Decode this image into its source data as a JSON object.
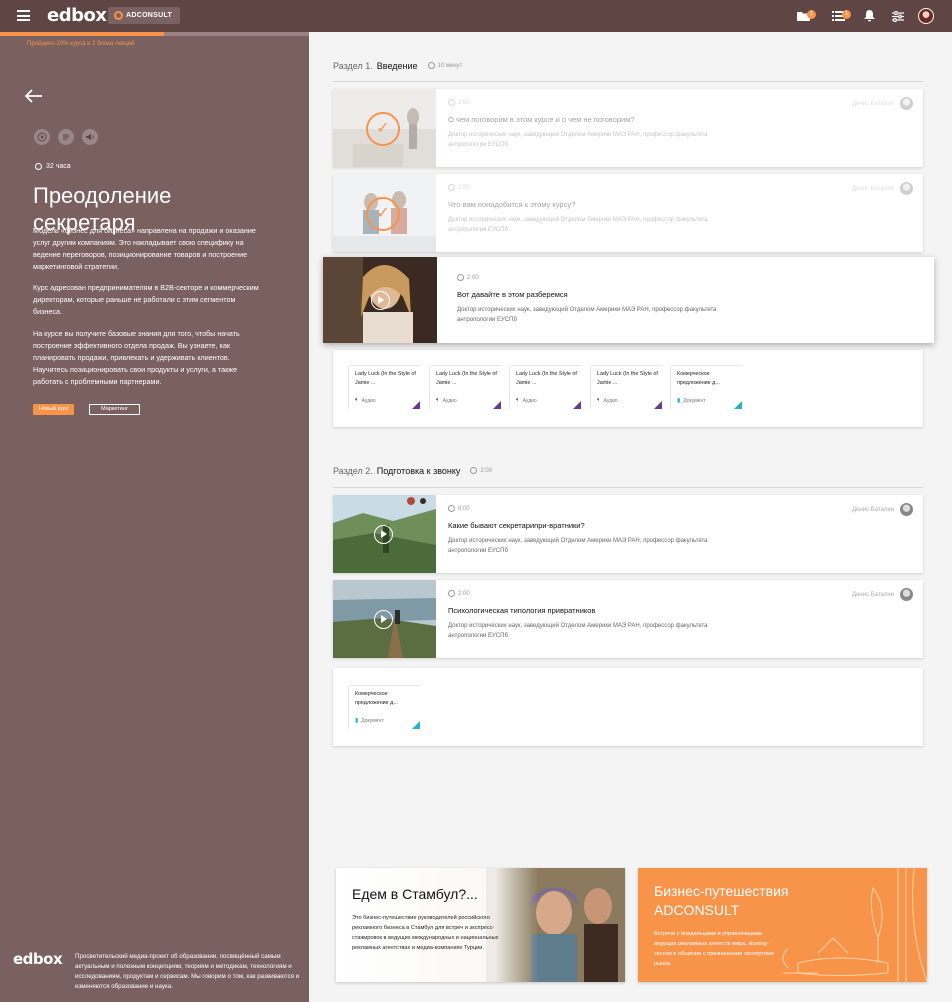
{
  "topbar": {
    "logo": "edbox",
    "partner_badge": "ADCONSULT",
    "folder_count": "1",
    "list_count": "1"
  },
  "course": {
    "progress_text": "Пройдено 20% курса и 2 блока лекций",
    "progress_percent": 53,
    "duration": "32 часа",
    "title": "Преодоление секретаря",
    "paragraphs": [
      "Модель «бизнес для бизнеса» направлена на продажи и оказание услуг другим компаниям. Это накладывает свою специфику на ведение переговоров, позиционирование товаров и построение маркетинговой стратегии.",
      "Курс адресован предпринимателям в B2B-секторе и коммерческим директорам, которые раньше не работали с этим сегментом бизнеса.",
      "На курсе вы получите базовые знания для того, чтобы начать построение эффективного отдела продаж. Вы узнаете, как планировать продажи, привлекать и удерживать клиентов. Научитесь позиционировать свои продукты и услуги, а также работать с проблемными партнерами."
    ],
    "tags": [
      "Новый курс",
      "Маркетинг"
    ]
  },
  "footer": {
    "logo": "edbox",
    "text": "Просветительский медиа-проект об образовании, посвящённый самым актуальным и полезным концепциям, теориям и методикам, технологиям и исследованиям, продуктам и сервисам. Мы говорим о том, как развиваются и изменяются образование и наука."
  },
  "sections": [
    {
      "prefix": "Раздел 1.",
      "name": "Введение",
      "duration": "10 минут",
      "lessons": [
        {
          "duration": "2:00",
          "title": "О чем поговорим в этом курсе и о чем не поговорим?",
          "desc": "Доктор исторических наук, заведующий Отделом Америки МАЭ РАН, профессор факультета антропологии ЕУСПб",
          "author": "Денис Баталин"
        },
        {
          "duration": "2:00",
          "title": "Что вам понадобится к этому курсу?",
          "desc": "Доктор исторических наук, заведующий Отделом Америки МАЭ РАН, профессор факультета антропологии ЕУСПб",
          "author": "Денис Баталин"
        },
        {
          "duration": "2:00",
          "title": "Вот давайте в этом разберемся",
          "desc": "Доктор исторических наук, заведующий Отделом Америки МАЭ РАН, профессор факультета антропологии ЕУСПб",
          "author": ""
        }
      ],
      "materials": [
        {
          "title": "Lady Luck (In the Style of Jamie ...",
          "type": "Аудио"
        },
        {
          "title": "Lady Luck (In the Style of Jamie ...",
          "type": "Аудио"
        },
        {
          "title": "Lady Luck (In the Style of Jamie ...",
          "type": "Аудио"
        },
        {
          "title": "Lady Luck (In the Style of Jamie ...",
          "type": "Аудио"
        },
        {
          "title": "Комерческое предложение д...",
          "type": "Документ"
        }
      ]
    },
    {
      "prefix": "Раздел 2.",
      "name": "Подготовка к звонку",
      "duration": "2:00",
      "lessons": [
        {
          "duration": "6:00",
          "title": "Какие бывают секретарипри-вратники?",
          "desc": "Доктор исторических наук, заведующий Отделом Америки МАЭ РАН, профессор факультета антропологии ЕУСПб",
          "author": "Денис Баталин"
        },
        {
          "duration": "2:00",
          "title": "Психологическая типология привратников",
          "desc": "Доктор исторических наук, заведующий Отделом Америки МАЭ РАН, профессор факультета антропологии ЕУСПб",
          "author": "Денис Баталин"
        }
      ],
      "materials": [
        {
          "title": "Комерческое предложение д...",
          "type": "Документ"
        }
      ]
    }
  ],
  "banners": [
    {
      "title": "Едем в Стамбул?...",
      "text": "Это бизнес-путешествие руководителей российского рекламного бизнеса в Стамбул для встреч и экспресс-стажировок в ведущих международных и национальных рекламных агентствах и медиа-компаниях Турции."
    },
    {
      "title": "Бизнес-путешествия ADCONSULT",
      "text": "Встречи с владельцами и управляющими ведущих рекламных агентств мира, sharing-сессии и общение с признанными экспертами рынка."
    }
  ],
  "colors": {
    "accent": "#f7944a",
    "panel": "#7a6160",
    "topbar": "#5f4645",
    "audio": "#6b3a8f",
    "document": "#22b5c4"
  }
}
